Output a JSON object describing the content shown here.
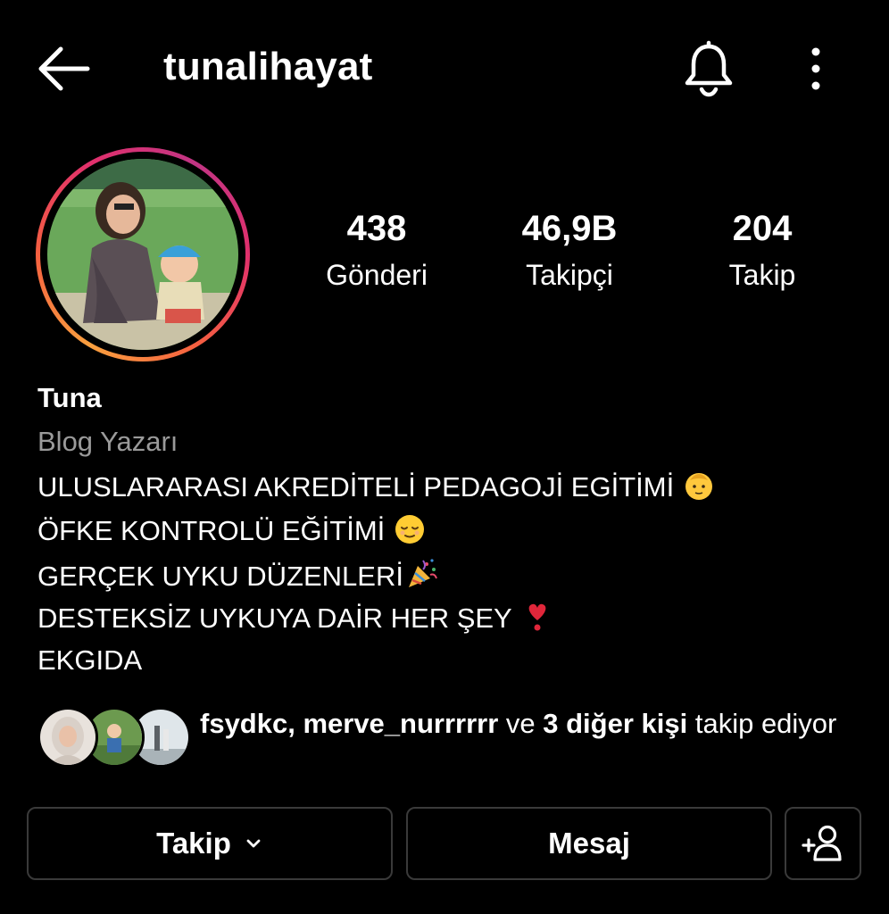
{
  "header": {
    "username": "tunalihayat",
    "back_icon": "arrow-left-icon",
    "bell_icon": "bell-icon",
    "more_icon": "more-vertical-icon"
  },
  "profile": {
    "avatar_ring_colors": [
      "#f9a03f",
      "#e1306c",
      "#c13584"
    ],
    "stats": [
      {
        "value": "438",
        "label": "Gönderi"
      },
      {
        "value": "46,9B",
        "label": "Takipçi"
      },
      {
        "value": "204",
        "label": "Takip"
      }
    ]
  },
  "bio": {
    "name": "Tuna",
    "category": "Blog Yazarı",
    "lines": [
      "ULUSLARARASI AKREDİTELİ PEDAGOJİ EGİTİMİ",
      "ÖFKE KONTROLÜ EĞİTİMİ",
      "GERÇEK UYKU DÜZENLERİ",
      "DESTEKSİZ UYKUYA DAİR HER ŞEY",
      "EKGIDA"
    ]
  },
  "followed_by": {
    "users": "fsydkc, merve_nurrrrrr",
    "connector": " ve ",
    "others": "3 diğer kişi",
    "suffix": " takip ediyor"
  },
  "actions": {
    "follow_label": "Takip",
    "message_label": "Mesaj",
    "add_user_icon": "add-person-icon"
  },
  "colors": {
    "background": "#000000",
    "secondary_text": "#9a9a9a",
    "button_border": "#3a3a3a"
  }
}
